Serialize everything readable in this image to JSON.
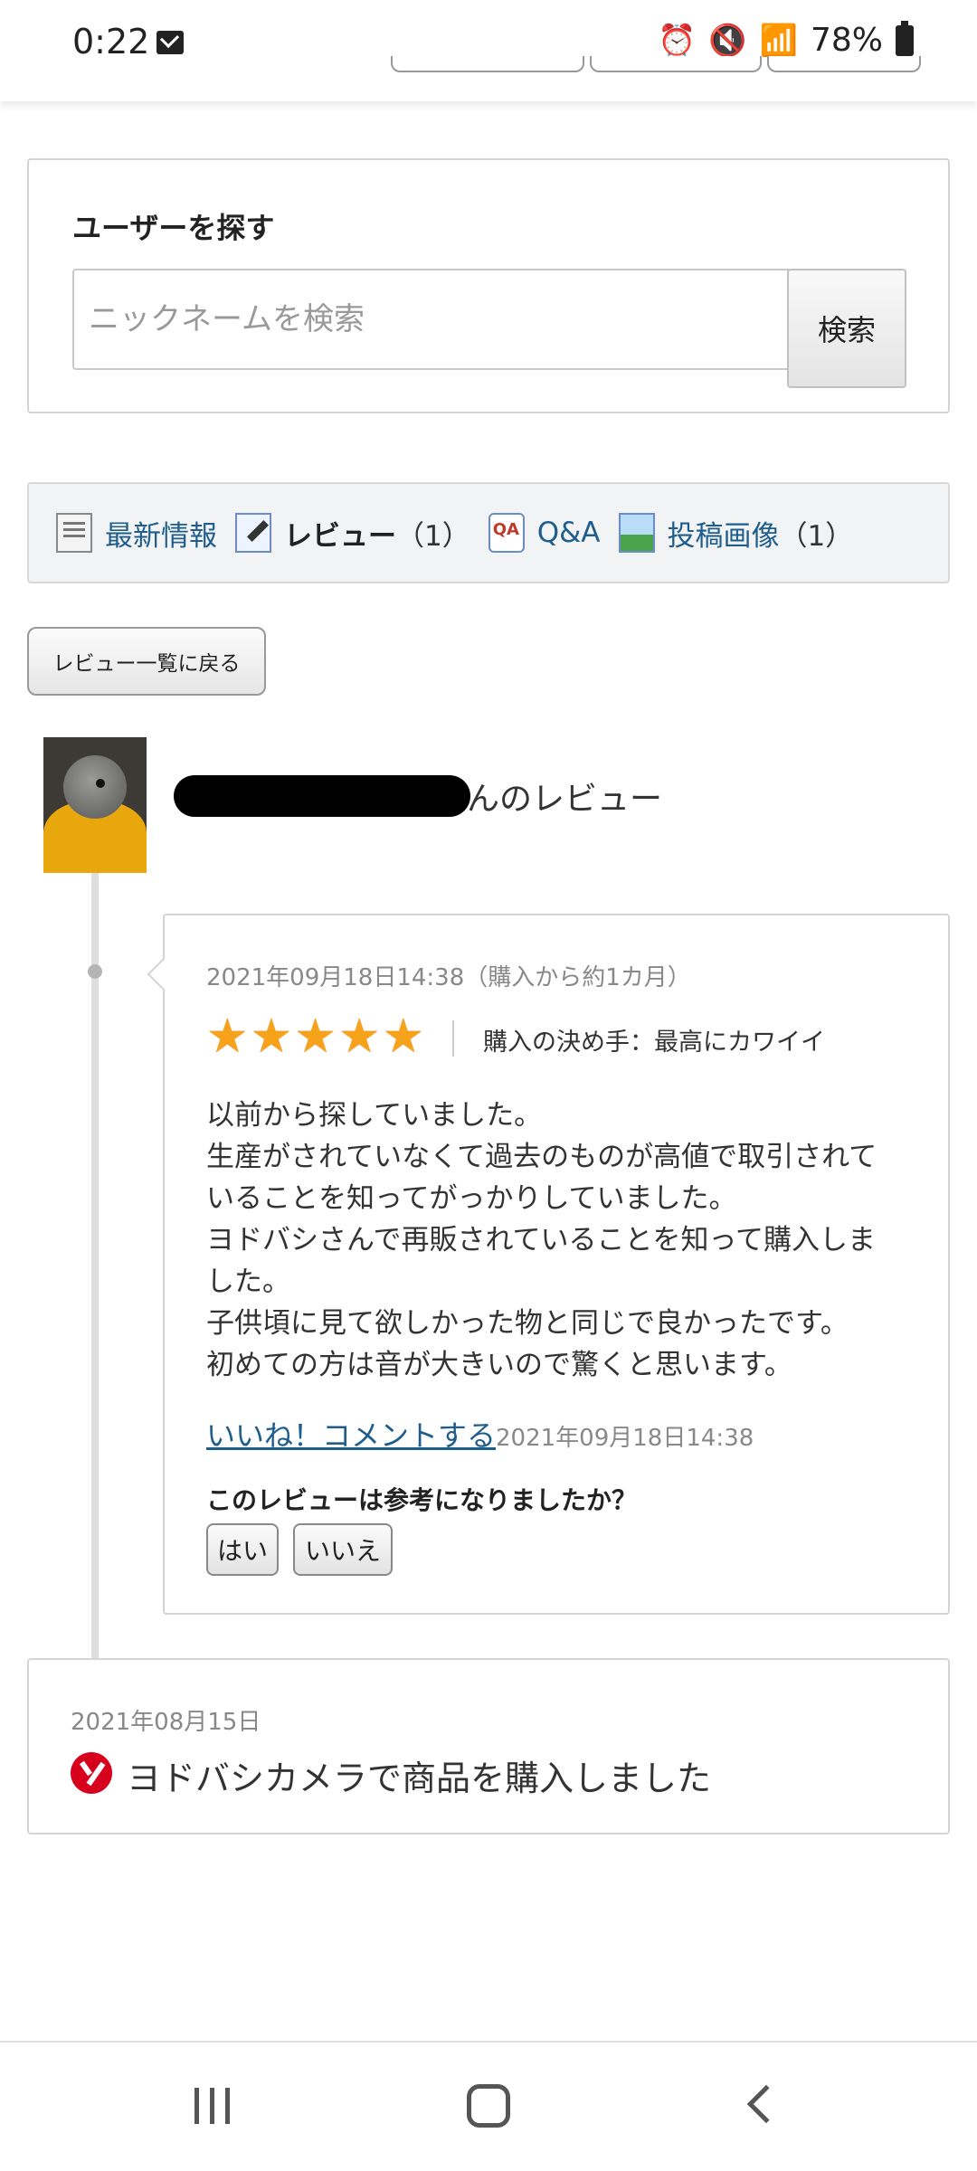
{
  "status_bar": {
    "time": "0:22",
    "battery": "78%",
    "icons": [
      "mail-icon",
      "alarm-icon",
      "mute-icon",
      "wifi-icon",
      "signal-icon",
      "battery-icon"
    ]
  },
  "user_search": {
    "title": "ユーザーを探す",
    "placeholder": "ニックネームを検索",
    "button": "検索"
  },
  "nav": {
    "items": [
      {
        "label": "最新情報",
        "icon": "news-icon"
      },
      {
        "label": "レビュー",
        "count": "（1）",
        "current": true,
        "icon": "review-pencil-icon"
      },
      {
        "label": "Q&A",
        "icon": "qa-icon"
      },
      {
        "label": "投稿画像",
        "count": "（1）",
        "icon": "image-icon"
      }
    ]
  },
  "back_button": "レビュー一覧に戻る",
  "reviewer": {
    "name_suffix": "んのレビュー"
  },
  "review": {
    "date": "2021年09月18日14:38（購入から約1カ月）",
    "rating": 5,
    "rating_max": 5,
    "decision": "購入の決め手：最高にカワイイ",
    "body_lines": [
      "以前から探していました。",
      "生産がされていなくて過去のものが高値で取引されて",
      "いることを知ってがっかりしていました。",
      "ヨドバシさんで再販されていることを知って購入しま",
      "した。",
      "子供頃に見て欲しかった物と同じで良かったです。",
      "初めての方は音が大きいので驚くと思います。"
    ],
    "like_comment": "いいね！コメントする",
    "timestamp": "2021年09月18日14:38",
    "helpful_question": "このレビューは参考になりましたか？",
    "yes": "はい",
    "no": "いいえ"
  },
  "purchase": {
    "date": "2021年08月15日",
    "text": "ヨドバシカメラで商品を購入しました"
  },
  "colors": {
    "link": "#1e5d8c",
    "star": "#f7a21b",
    "yodobashi_red": "#d7001d",
    "border": "#d4d4d4"
  }
}
